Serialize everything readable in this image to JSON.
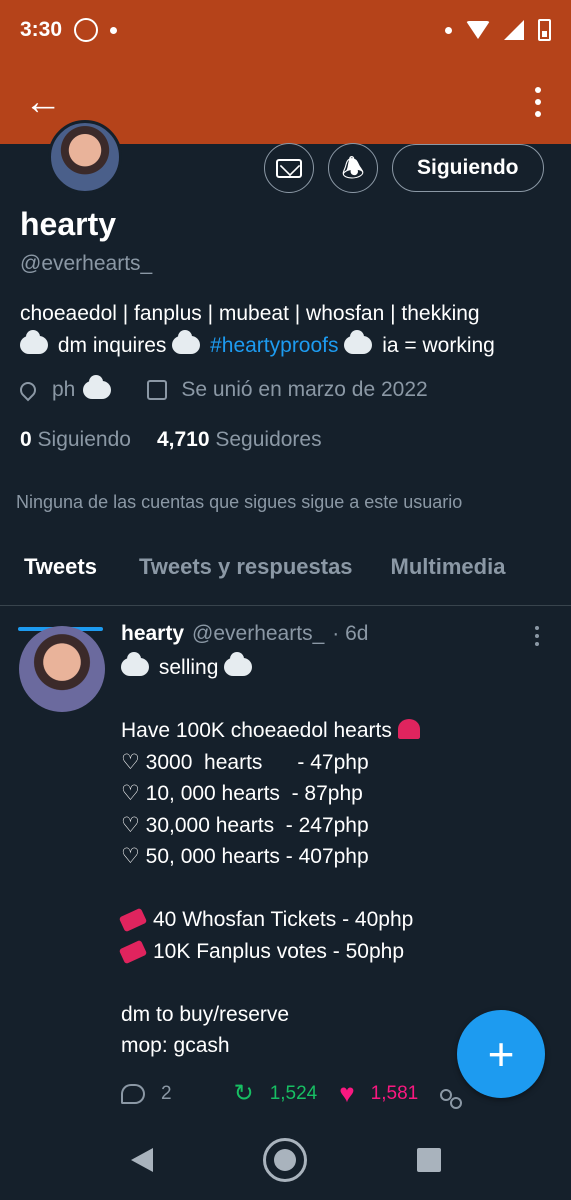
{
  "status_bar": {
    "time": "3:30"
  },
  "profile": {
    "name": "hearty",
    "handle": "@everhearts_",
    "follow_label": "Siguiendo",
    "bio_line1": "choeaedol | fanplus | mubeat | whosfan | thekking",
    "bio_line2_a": "dm inquires",
    "bio_line2_hashtag": "#heartyproofs",
    "bio_line2_b": "ia = working",
    "location": "ph",
    "joined": "Se unió en marzo de 2022",
    "following_count": "0",
    "following_label": "Siguiendo",
    "followers_count": "4,710",
    "followers_label": "Seguidores",
    "notice": "Ninguna de las cuentas que sigues sigue a este usuario"
  },
  "tabs": [
    "Tweets",
    "Tweets y respuestas",
    "Multimedia"
  ],
  "tweet": {
    "name": "hearty",
    "handle": "@everhearts_",
    "time": "· 6d",
    "line_selling": "selling",
    "line_have": "Have 100K choeaedol hearts",
    "price_lines": [
      "♡ 3000  hearts      - 47php",
      "♡ 10, 000 hearts  - 87php",
      "♡ 30,000 hearts  - 247php",
      "♡ 50, 000 hearts - 407php"
    ],
    "ticket_lines": [
      "40 Whosfan Tickets - 40php",
      "10K Fanplus votes - 50php"
    ],
    "dm_line": "dm to buy/reserve",
    "mop_line": "mop: gcash",
    "replies": "2",
    "retweets": "1,524",
    "likes": "1,581"
  },
  "colors": {
    "accent": "#1d9bf0",
    "appbar": "#b5431a",
    "background": "#15202b",
    "retweet": "#17bf63",
    "like": "#f91880"
  }
}
